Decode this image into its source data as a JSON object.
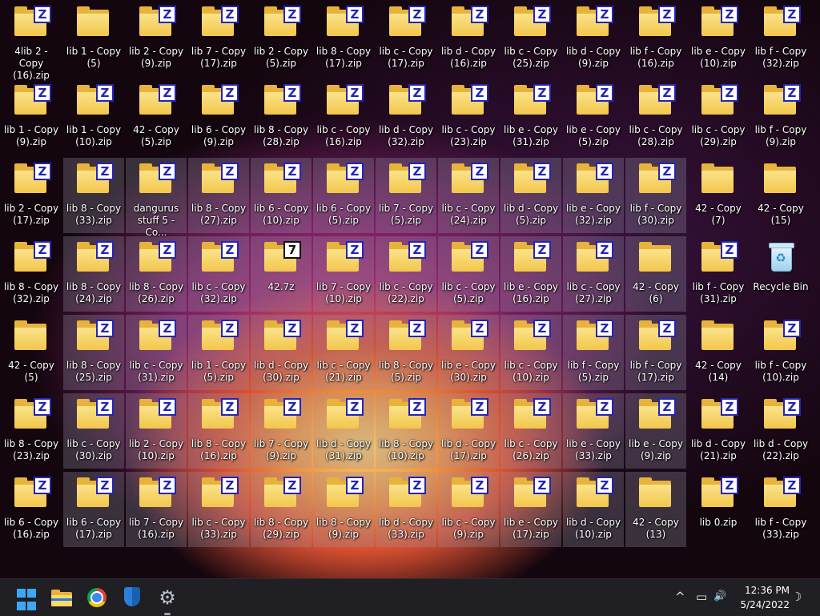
{
  "desktop": {
    "icons": [
      {
        "label": "4lib 2 - Copy (16).zip",
        "type": "zip",
        "selected": false
      },
      {
        "label": "lib 1 - Copy (5)",
        "type": "folder",
        "selected": false
      },
      {
        "label": "lib 2 - Copy (9).zip",
        "type": "zip",
        "selected": false
      },
      {
        "label": "lib 7 - Copy (17).zip",
        "type": "zip",
        "selected": false
      },
      {
        "label": "lib 2 - Copy (5).zip",
        "type": "zip",
        "selected": false
      },
      {
        "label": "lib 8 - Copy (17).zip",
        "type": "zip",
        "selected": false
      },
      {
        "label": "lib c - Copy (17).zip",
        "type": "zip",
        "selected": false
      },
      {
        "label": "lib d - Copy (16).zip",
        "type": "zip",
        "selected": false
      },
      {
        "label": "lib c - Copy (25).zip",
        "type": "zip",
        "selected": false
      },
      {
        "label": "lib d - Copy (9).zip",
        "type": "zip",
        "selected": false
      },
      {
        "label": "lib f - Copy (16).zip",
        "type": "zip",
        "selected": false
      },
      {
        "label": "lib e - Copy (10).zip",
        "type": "zip",
        "selected": false
      },
      {
        "label": "lib f - Copy (32).zip",
        "type": "zip",
        "selected": false
      },
      {
        "label": "lib 1 - Copy (9).zip",
        "type": "zip",
        "selected": false
      },
      {
        "label": "lib 1 - Copy (10).zip",
        "type": "zip",
        "selected": false
      },
      {
        "label": "42 - Copy (5).zip",
        "type": "zip",
        "selected": false
      },
      {
        "label": "lib 6 - Copy (9).zip",
        "type": "zip",
        "selected": false
      },
      {
        "label": "lib 8 - Copy (28).zip",
        "type": "zip",
        "selected": false
      },
      {
        "label": "lib c - Copy (16).zip",
        "type": "zip",
        "selected": false
      },
      {
        "label": "lib d - Copy (32).zip",
        "type": "zip",
        "selected": false
      },
      {
        "label": "lib c - Copy (23).zip",
        "type": "zip",
        "selected": false
      },
      {
        "label": "lib e - Copy (31).zip",
        "type": "zip",
        "selected": false
      },
      {
        "label": "lib e - Copy (5).zip",
        "type": "zip",
        "selected": false
      },
      {
        "label": "lib c - Copy (28).zip",
        "type": "zip",
        "selected": false
      },
      {
        "label": "lib c - Copy (29).zip",
        "type": "zip",
        "selected": false
      },
      {
        "label": "lib f - Copy (9).zip",
        "type": "zip",
        "selected": false
      },
      {
        "label": "lib 2 - Copy (17).zip",
        "type": "zip",
        "selected": false
      },
      {
        "label": "lib 8 - Copy (33).zip",
        "type": "zip",
        "selected": true
      },
      {
        "label": "dangurus stuff 5 - Co...",
        "type": "zip",
        "selected": true
      },
      {
        "label": "lib 8 - Copy (27).zip",
        "type": "zip",
        "selected": true
      },
      {
        "label": "lib 6 - Copy (10).zip",
        "type": "zip",
        "selected": true
      },
      {
        "label": "lib 6 - Copy (5).zip",
        "type": "zip",
        "selected": true
      },
      {
        "label": "lib 7 - Copy (5).zip",
        "type": "zip",
        "selected": true
      },
      {
        "label": "lib c - Copy (24).zip",
        "type": "zip",
        "selected": true
      },
      {
        "label": "lib d - Copy (5).zip",
        "type": "zip",
        "selected": true
      },
      {
        "label": "lib e - Copy (32).zip",
        "type": "zip",
        "selected": true
      },
      {
        "label": "lib f - Copy (30).zip",
        "type": "zip",
        "selected": true
      },
      {
        "label": "42 - Copy (7)",
        "type": "folder",
        "selected": false
      },
      {
        "label": "42 - Copy (15)",
        "type": "folder",
        "selected": false
      },
      {
        "label": "lib 8 - Copy (32).zip",
        "type": "zip",
        "selected": false
      },
      {
        "label": "lib 8 - Copy (24).zip",
        "type": "zip",
        "selected": true
      },
      {
        "label": "lib 8 - Copy (26).zip",
        "type": "zip",
        "selected": true
      },
      {
        "label": "lib c - Copy (32).zip",
        "type": "zip",
        "selected": true
      },
      {
        "label": "42.7z",
        "type": "7z",
        "selected": true
      },
      {
        "label": "lib 7 - Copy (10).zip",
        "type": "zip",
        "selected": true
      },
      {
        "label": "lib c - Copy (22).zip",
        "type": "zip",
        "selected": true
      },
      {
        "label": "lib c - Copy (5).zip",
        "type": "zip",
        "selected": true
      },
      {
        "label": "lib e - Copy (16).zip",
        "type": "zip",
        "selected": true
      },
      {
        "label": "lib c - Copy (27).zip",
        "type": "zip",
        "selected": true
      },
      {
        "label": "42 - Copy (6)",
        "type": "folder",
        "selected": true
      },
      {
        "label": "lib f - Copy (31).zip",
        "type": "zip",
        "selected": false
      },
      {
        "label": "Recycle Bin",
        "type": "recycle",
        "selected": false
      },
      {
        "label": "42 - Copy (5)",
        "type": "folder",
        "selected": false
      },
      {
        "label": "lib 8 - Copy (25).zip",
        "type": "zip",
        "selected": true
      },
      {
        "label": "lib c - Copy (31).zip",
        "type": "zip",
        "selected": true
      },
      {
        "label": "lib 1 - Copy (5).zip",
        "type": "zip",
        "selected": true
      },
      {
        "label": "lib d - Copy (30).zip",
        "type": "zip",
        "selected": true
      },
      {
        "label": "lib c - Copy (21).zip",
        "type": "zip",
        "selected": true
      },
      {
        "label": "lib 8 - Copy (5).zip",
        "type": "zip",
        "selected": true
      },
      {
        "label": "lib e - Copy (30).zip",
        "type": "zip",
        "selected": true
      },
      {
        "label": "lib c - Copy (10).zip",
        "type": "zip",
        "selected": true
      },
      {
        "label": "lib f - Copy (5).zip",
        "type": "zip",
        "selected": true
      },
      {
        "label": "lib f - Copy (17).zip",
        "type": "zip",
        "selected": true
      },
      {
        "label": "42 - Copy (14)",
        "type": "folder",
        "selected": false
      },
      {
        "label": "lib f - Copy (10).zip",
        "type": "zip",
        "selected": false
      },
      {
        "label": "lib 8 - Copy (23).zip",
        "type": "zip",
        "selected": false
      },
      {
        "label": "lib c - Copy (30).zip",
        "type": "zip",
        "selected": true
      },
      {
        "label": "lib 2 - Copy (10).zip",
        "type": "zip",
        "selected": true
      },
      {
        "label": "lib 8 - Copy (16).zip",
        "type": "zip",
        "selected": true
      },
      {
        "label": "lib 7 - Copy (9).zip",
        "type": "zip",
        "selected": true
      },
      {
        "label": "lib d - Copy (31).zip",
        "type": "zip",
        "selected": true
      },
      {
        "label": "lib 8 - Copy (10).zip",
        "type": "zip",
        "selected": true
      },
      {
        "label": "lib d - Copy (17).zip",
        "type": "zip",
        "selected": true
      },
      {
        "label": "lib c - Copy (26).zip",
        "type": "zip",
        "selected": true
      },
      {
        "label": "lib e - Copy (33).zip",
        "type": "zip",
        "selected": true
      },
      {
        "label": "lib e - Copy (9).zip",
        "type": "zip",
        "selected": true
      },
      {
        "label": "lib d - Copy (21).zip",
        "type": "zip",
        "selected": false
      },
      {
        "label": "lib d - Copy (22).zip",
        "type": "zip",
        "selected": false
      },
      {
        "label": "lib 6 - Copy (16).zip",
        "type": "zip",
        "selected": false
      },
      {
        "label": "lib 6 - Copy (17).zip",
        "type": "zip",
        "selected": true
      },
      {
        "label": "lib 7 - Copy (16).zip",
        "type": "zip",
        "selected": true
      },
      {
        "label": "lib c - Copy (33).zip",
        "type": "zip",
        "selected": true
      },
      {
        "label": "lib 8 - Copy (29).zip",
        "type": "zip",
        "selected": true
      },
      {
        "label": "lib 8 - Copy (9).zip",
        "type": "zip",
        "selected": true
      },
      {
        "label": "lib d - Copy (33).zip",
        "type": "zip",
        "selected": true
      },
      {
        "label": "lib c - Copy (9).zip",
        "type": "zip",
        "selected": true
      },
      {
        "label": "lib e - Copy (17).zip",
        "type": "zip",
        "selected": true
      },
      {
        "label": "lib d - Copy (10).zip",
        "type": "zip",
        "selected": true
      },
      {
        "label": "42 - Copy (13)",
        "type": "folder",
        "selected": true
      },
      {
        "label": "lib 0.zip",
        "type": "zip",
        "selected": false
      },
      {
        "label": "lib f - Copy (33).zip",
        "type": "zip",
        "selected": false
      }
    ]
  },
  "taskbar": {
    "apps": [
      {
        "name": "start",
        "icon": "windows-logo-icon"
      },
      {
        "name": "file-explorer",
        "icon": "folder-icon"
      },
      {
        "name": "chrome",
        "icon": "chrome-icon"
      },
      {
        "name": "security",
        "icon": "shield-icon"
      },
      {
        "name": "settings",
        "icon": "gear-icon"
      }
    ],
    "tray": {
      "chevron": "^",
      "network": "▭",
      "volume": "🔊",
      "focus": "☽"
    },
    "clock": {
      "time": "12:36 PM",
      "date": "5/24/2022"
    }
  }
}
